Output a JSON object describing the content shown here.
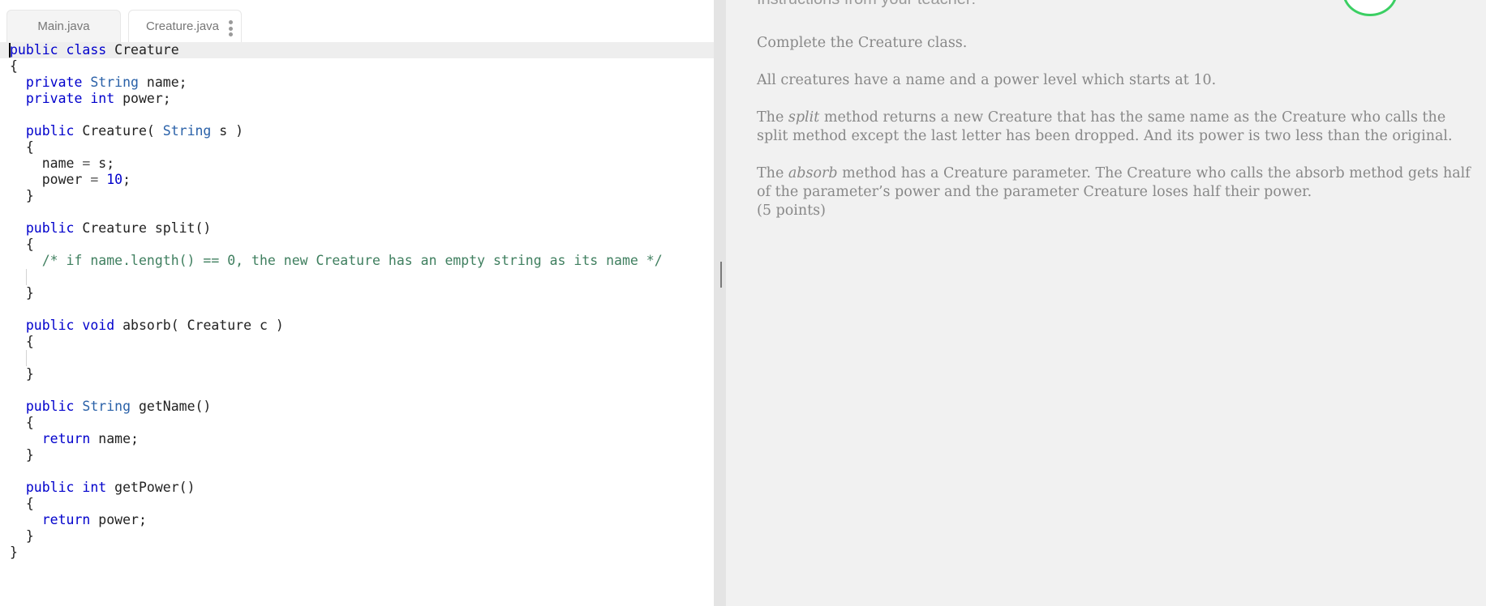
{
  "tabs": [
    {
      "label": "Main.java",
      "active": false
    },
    {
      "label": "Creature.java",
      "active": true
    }
  ],
  "editor": {
    "lines": [
      "public class Creature",
      "{",
      "  private String name;",
      "  private int power;",
      "",
      "  public Creature( String s )",
      "  {",
      "    name = s;",
      "    power = 10;",
      "  }",
      "",
      "  public Creature split()",
      "  {",
      "    /* if name.length() == 0, the new Creature has an empty string as its name */",
      "",
      "  }",
      "",
      "  public void absorb( Creature c )",
      "  {",
      "",
      "  }",
      "",
      "  public String getName()",
      "  {",
      "    return name;",
      "  }",
      "",
      "  public int getPower()",
      "  {",
      "    return power;",
      "  }",
      "}"
    ]
  },
  "instructions": {
    "header": "Instructions from your teacher:",
    "p1": "Complete the Creature class.",
    "p2": "All creatures have a name and a power level which starts at 10.",
    "p3_intro": "The ",
    "p3_em": "split",
    "p3_rest": " method returns a new Creature that has the same name as the Creature who calls the split method except the last letter has been dropped. And its power is two less than the original.",
    "p4_intro": "The ",
    "p4_em": "absorb",
    "p4_rest": " method has a Creature parameter. The Creature who calls the absorb method gets half of the parameter’s power and the parameter Creature loses half their power.",
    "points": "(5 points)"
  },
  "colors": {
    "keyword": "#0000cc",
    "type": "#2a61a8",
    "comment": "#3f7f5f",
    "badge_border": "#3bcf63"
  }
}
